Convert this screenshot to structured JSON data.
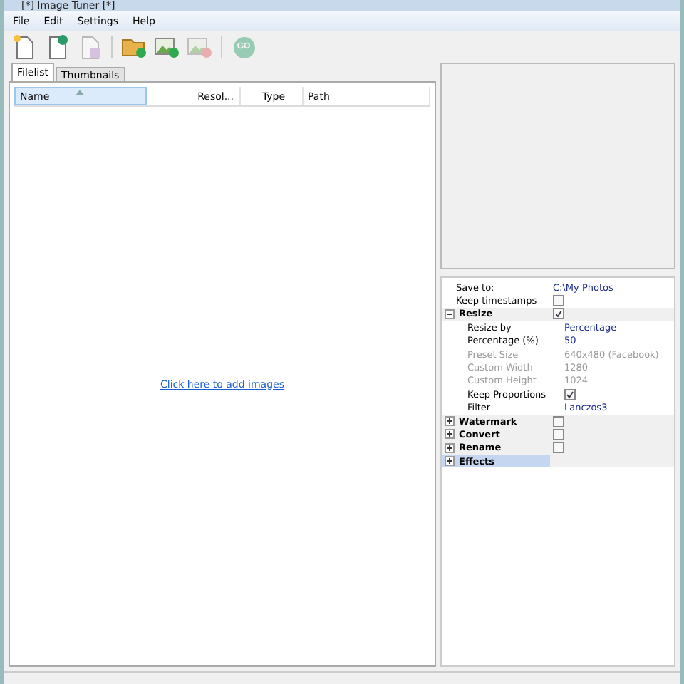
{
  "window": {
    "title": "[*] Image Tuner [*]"
  },
  "menu": [
    "File",
    "Edit",
    "Settings",
    "Help"
  ],
  "toolbar": [
    {
      "kind": "new",
      "disabled": false
    },
    {
      "kind": "new-green",
      "disabled": false
    },
    {
      "kind": "save",
      "disabled": true
    },
    {
      "kind": "folder-add",
      "disabled": false
    },
    {
      "kind": "image-add",
      "disabled": false
    },
    {
      "kind": "image-remove",
      "disabled": true
    },
    {
      "kind": "go",
      "label": "GO",
      "disabled": true
    }
  ],
  "tabs": [
    {
      "label": "Filelist",
      "selected": true
    },
    {
      "label": "Thumbnails",
      "selected": false
    }
  ],
  "table": {
    "columns": [
      {
        "label": "Name",
        "sorted": true
      },
      {
        "label": "Resol...",
        "sorted": false
      },
      {
        "label": "Type",
        "sorted": false
      },
      {
        "label": "Path",
        "sorted": false
      }
    ],
    "empty_link": "Click here to add images"
  },
  "properties": [
    {
      "kind": "text",
      "label": "Save to:",
      "value": "C:\\My Photos",
      "disabled": false
    },
    {
      "kind": "check",
      "label": "Keep timestamps",
      "checked": false,
      "disabled": false
    },
    {
      "kind": "group",
      "label": "Resize",
      "expanded": true,
      "checked": true,
      "selected": false,
      "children": [
        {
          "kind": "text",
          "label": "Resize by",
          "value": "Percentage",
          "disabled": false
        },
        {
          "kind": "text",
          "label": "Percentage (%)",
          "value": "50",
          "disabled": false
        },
        {
          "kind": "text",
          "label": "Preset Size",
          "value": "640x480 (Facebook)",
          "disabled": true
        },
        {
          "kind": "text",
          "label": "Custom Width",
          "value": "1280",
          "disabled": true
        },
        {
          "kind": "text",
          "label": "Custom Height",
          "value": "1024",
          "disabled": true
        },
        {
          "kind": "check",
          "label": "Keep Proportions",
          "checked": true,
          "disabled": false
        },
        {
          "kind": "text",
          "label": "Filter",
          "value": "Lanczos3",
          "disabled": false
        }
      ]
    },
    {
      "kind": "group",
      "label": "Watermark",
      "expanded": false,
      "checked": false,
      "selected": false
    },
    {
      "kind": "group",
      "label": "Convert",
      "expanded": false,
      "checked": false,
      "selected": false
    },
    {
      "kind": "group",
      "label": "Rename",
      "expanded": false,
      "checked": false,
      "selected": false
    },
    {
      "kind": "group",
      "label": "Effects",
      "expanded": false,
      "selected": true
    }
  ]
}
